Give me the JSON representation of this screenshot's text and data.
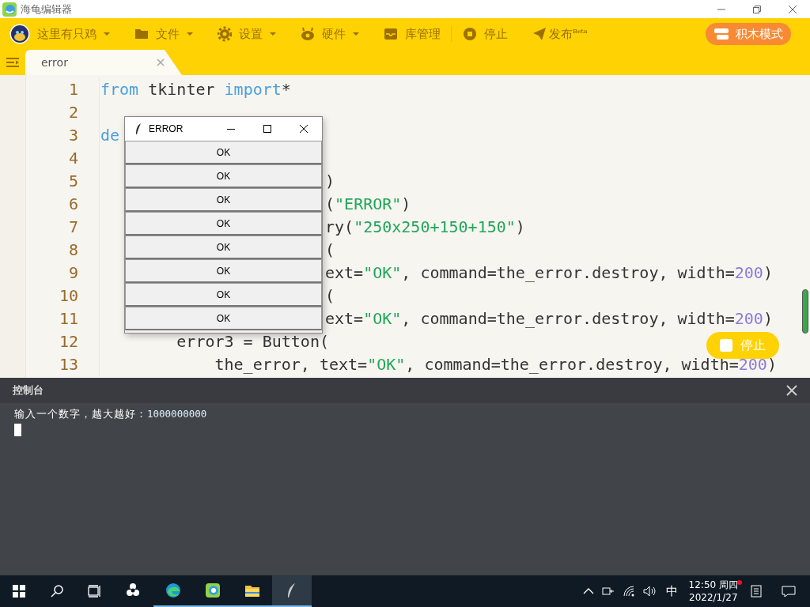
{
  "window": {
    "title": "海龟编辑器"
  },
  "toolbar": {
    "user": "这里有只鸡",
    "items": [
      {
        "label": "文件",
        "kind": "menu"
      },
      {
        "label": "设置",
        "kind": "menu"
      },
      {
        "label": "硬件",
        "kind": "menu"
      },
      {
        "label": "库管理",
        "kind": "action"
      },
      {
        "label": "停止",
        "kind": "action"
      },
      {
        "label": "发布$^{Beta}$",
        "kind": "action"
      }
    ],
    "mode_button": "积木模式"
  },
  "tabs": [
    {
      "label": "error",
      "selected": true
    }
  ],
  "code_lines": [
    {
      "number": "1",
      "covered": false,
      "segments": [
        {
          "kind": "keyword",
          "text": "from"
        },
        {
          "kind": "plain",
          "text": " tkinter "
        },
        {
          "kind": "keyword",
          "text": "import"
        },
        {
          "kind": "plain",
          "text": "*"
        }
      ]
    },
    {
      "number": "2"
    },
    {
      "number": "3",
      "covered": false,
      "segments": [
        {
          "kind": "keyword",
          "text": "de"
        }
      ]
    },
    {
      "number": "4"
    },
    {
      "number": "5",
      "covered": true,
      "segments": [
        {
          "kind": "plain",
          "text": ")"
        }
      ]
    },
    {
      "number": "6",
      "covered": true,
      "segments": [
        {
          "kind": "plain",
          "text": "("
        },
        {
          "kind": "string",
          "text": "\"ERROR\""
        },
        {
          "kind": "plain",
          "text": ")"
        }
      ]
    },
    {
      "number": "7",
      "covered": true,
      "segments": [
        {
          "kind": "plain",
          "text": "ry("
        },
        {
          "kind": "string",
          "text": "\"250x250+150+150\""
        },
        {
          "kind": "plain",
          "text": ")"
        }
      ]
    },
    {
      "number": "8",
      "covered": true,
      "segments": [
        {
          "kind": "plain",
          "text": "("
        }
      ]
    },
    {
      "number": "9",
      "covered": true,
      "segments": [
        {
          "kind": "plain",
          "text": "ext="
        },
        {
          "kind": "string",
          "text": "\"OK\""
        },
        {
          "kind": "plain",
          "text": ", command=the_error.destroy, width="
        },
        {
          "kind": "number",
          "text": "200"
        },
        {
          "kind": "plain",
          "text": ")"
        }
      ]
    },
    {
      "number": "10",
      "covered": true,
      "segments": [
        {
          "kind": "plain",
          "text": "("
        }
      ]
    },
    {
      "number": "11",
      "covered": true,
      "segments": [
        {
          "kind": "plain",
          "text": "ext="
        },
        {
          "kind": "string",
          "text": "\"OK\""
        },
        {
          "kind": "plain",
          "text": ", command=the_error.destroy, width="
        },
        {
          "kind": "number",
          "text": "200"
        },
        {
          "kind": "plain",
          "text": ")"
        }
      ]
    },
    {
      "number": "12",
      "covered": false,
      "segments": [
        {
          "kind": "plain",
          "text": "        error3 = Button("
        }
      ]
    },
    {
      "number": "13",
      "covered": false,
      "segments": [
        {
          "kind": "plain",
          "text": "            the_error, text="
        },
        {
          "kind": "string",
          "text": "\"OK\""
        },
        {
          "kind": "plain",
          "text": ", command=the_error.destroy, width="
        },
        {
          "kind": "number",
          "text": "200"
        },
        {
          "kind": "plain",
          "text": ")"
        }
      ]
    }
  ],
  "run_button": "停止",
  "dialog": {
    "title": "ERROR",
    "buttons": [
      "OK",
      "OK",
      "OK",
      "OK",
      "OK",
      "OK",
      "OK",
      "OK"
    ]
  },
  "console": {
    "title": "控制台",
    "segments": [
      {
        "kind": "prompt",
        "text": "输入一个数字，越大越好："
      },
      {
        "kind": "input",
        "text": "1000000000"
      }
    ]
  },
  "taskbar": {
    "apps": [
      {
        "running": false,
        "selected": false
      },
      {
        "running": true,
        "selected": false
      },
      {
        "running": true,
        "selected": false
      },
      {
        "running": true,
        "selected": false
      },
      {
        "running": true,
        "selected": true
      }
    ],
    "ime": "中",
    "time": "12:50 周四",
    "date": "2022/1/27",
    "notification": true
  }
}
